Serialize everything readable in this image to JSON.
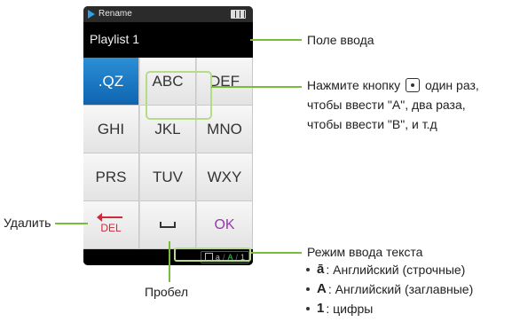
{
  "device": {
    "title": "Rename",
    "input_value": "Playlist 1",
    "keys": [
      ".QZ",
      "ABC",
      "DEF",
      "GHI",
      "JKL",
      "MNO",
      "PRS",
      "TUV",
      "WXY"
    ],
    "del_label": "DEL",
    "ok_label": "OK",
    "mode": {
      "lower": "a",
      "upper": "A",
      "number": "1",
      "sep": "/"
    },
    "colors": {
      "active_key": "#1a72c2",
      "ok": "#9a35b5",
      "del": "#cc2a3d",
      "highlight": "#b7dc88",
      "mode_upper": "#3bd05a"
    }
  },
  "callouts": {
    "input_field": "Поле ввода",
    "press_line1_before": "Нажмите кнопку",
    "press_line1_after": "один раз,",
    "press_line2": "чтобы ввести \"A\", два раза,",
    "press_line3": "чтобы ввести \"B\", и т.д",
    "delete": "Удалить",
    "space": "Пробел",
    "text_mode": "Режим ввода текста"
  },
  "legend": [
    {
      "glyph": "ā",
      "text": ": Английский (строчные)"
    },
    {
      "glyph": "A",
      "text": ": Английский (заглавные)"
    },
    {
      "glyph": "1",
      "text": ": цифры"
    }
  ]
}
